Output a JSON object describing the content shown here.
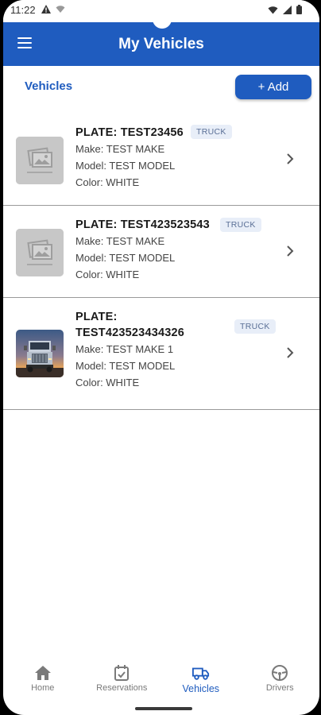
{
  "status_bar": {
    "time": "11:22"
  },
  "app_bar": {
    "title": "My Vehicles"
  },
  "section": {
    "title": "Vehicles",
    "add_label": "+ Add"
  },
  "vehicles": [
    {
      "plate": "PLATE: TEST23456",
      "type": "TRUCK",
      "make": "Make: TEST MAKE",
      "model": "Model: TEST MODEL",
      "color": "Color: WHITE",
      "image": "placeholder"
    },
    {
      "plate": "PLATE: TEST423523543",
      "type": "TRUCK",
      "make": "Make: TEST MAKE",
      "model": "Model: TEST MODEL",
      "color": "Color: WHITE",
      "image": "placeholder"
    },
    {
      "plate": "PLATE: TEST423523434326",
      "type": "TRUCK",
      "make": "Make: TEST MAKE 1",
      "model": "Model: TEST MODEL",
      "color": "Color: WHITE",
      "image": "truck-photo"
    }
  ],
  "nav": [
    {
      "label": "Home",
      "icon": "home-icon",
      "active": false
    },
    {
      "label": "Reservations",
      "icon": "calendar-check-icon",
      "active": false
    },
    {
      "label": "Vehicles",
      "icon": "truck-icon",
      "active": true
    },
    {
      "label": "Drivers",
      "icon": "steering-wheel-icon",
      "active": false
    }
  ],
  "colors": {
    "primary": "#1f5cbf",
    "badge_bg": "#e8eef8",
    "badge_text": "#5a6f96"
  }
}
